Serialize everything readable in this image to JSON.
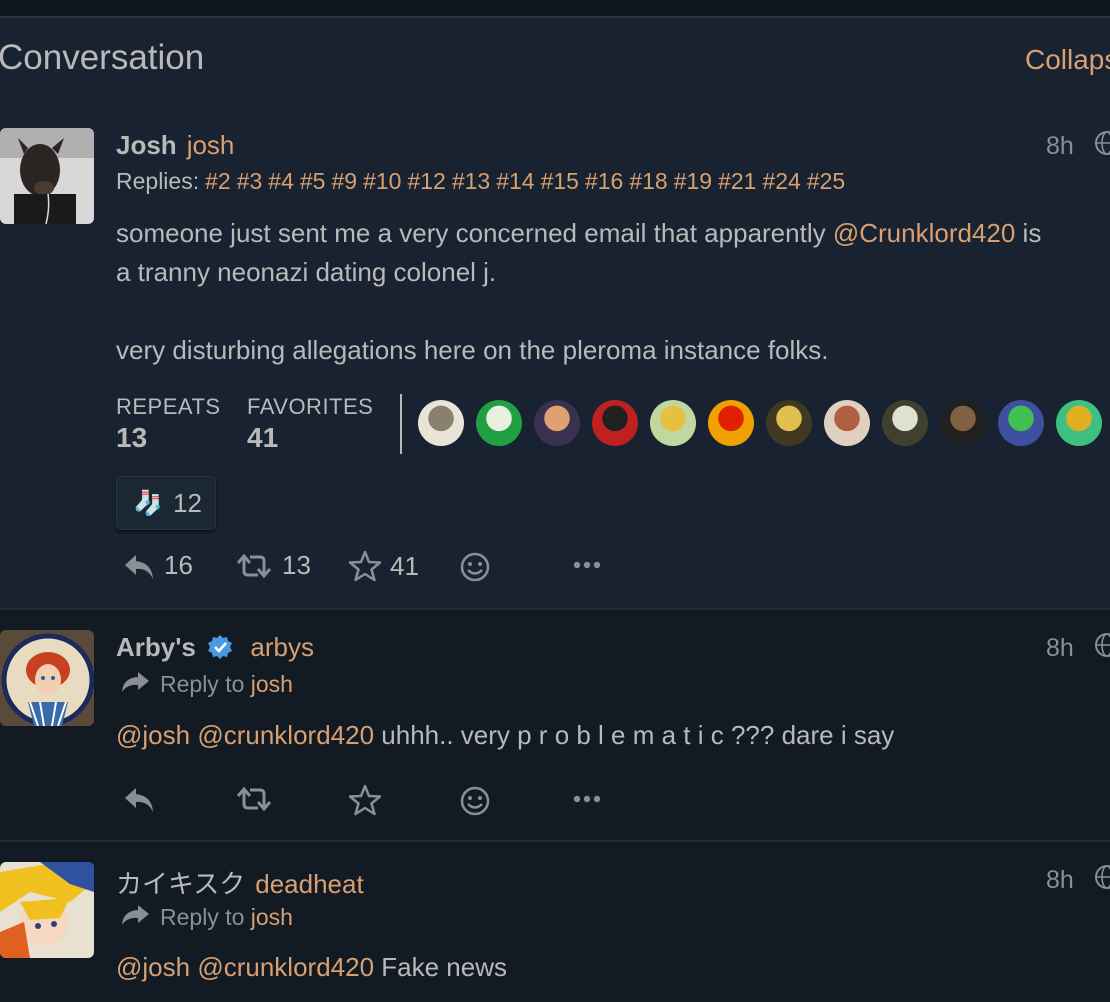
{
  "header": {
    "title": "Conversation",
    "collapse_label": "Collapse"
  },
  "colors": {
    "accent": "#d8a070",
    "background": "#121a24",
    "panel": "#182230",
    "text": "#b9b9ba",
    "verified": "#4a9ae0"
  },
  "statuses": [
    {
      "display_name": "Josh",
      "handle": "josh",
      "time": "8h",
      "replies_label": "Replies:",
      "replies": [
        "#2",
        "#3",
        "#4",
        "#5",
        "#9",
        "#10",
        "#12",
        "#13",
        "#14",
        "#15",
        "#16",
        "#18",
        "#19",
        "#21",
        "#24",
        "#25"
      ],
      "content_prefix": "someone just sent me a very concerned email that apparently ",
      "content_mention": "@Crunklord420",
      "content_suffix": " is",
      "content_line2": "a tranny neonazi dating colonel j.",
      "content_line3": "very disturbing allegations here on the pleroma instance folks.",
      "repeats_label": "REPEATS",
      "repeats_count": "13",
      "favorites_label": "FAVORITES",
      "favorites_count": "41",
      "reaction_emoji": "🧦",
      "reaction_count": "12",
      "reply_count": "16",
      "repeat_count": "13",
      "fav_count": "41"
    },
    {
      "display_name": "Arby's",
      "handle": "arbys",
      "time": "8h",
      "reply_to_label": "Reply to",
      "reply_to": "josh",
      "mention1": "@josh",
      "mention2": "@crunklord420",
      "content": " uhhh.. very p r o b l e m a t i c ??? dare i say"
    },
    {
      "display_name": "カイキスク",
      "handle": "deadheat",
      "time": "8h",
      "reply_to_label": "Reply to",
      "reply_to": "josh",
      "mention1": "@josh",
      "mention2": "@crunklord420",
      "content": " Fake news"
    }
  ]
}
